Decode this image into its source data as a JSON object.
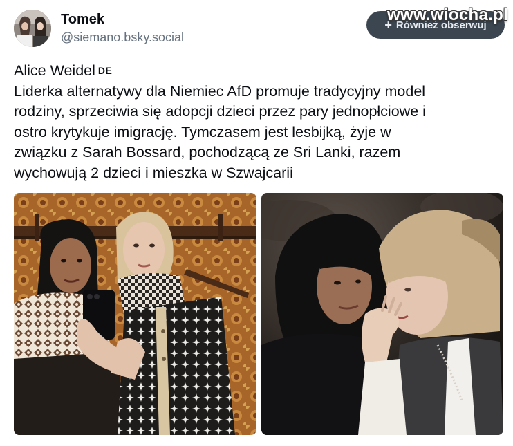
{
  "author": {
    "display_name": "Tomek",
    "handle": "@siemano.bsky.social",
    "avatar": "avatar-icon"
  },
  "follow_button": {
    "icon": "plus-icon",
    "label": "Również obserwuj"
  },
  "watermark": "www.wiocha.pl",
  "post": {
    "title": "Alice Weidel",
    "title_flag": "DE",
    "lines": [
      "Liderka alternatywy dla Niemiec AfD promuje tradycyjny model",
      "rodziny, sprzeciwia się adopcji dzieci przez pary jednopłciowe i",
      "ostro krytykuje imigrację. Tymczasem jest lesbijką, żyje w",
      "związku z Sarah Bossard, pochodzącą ze Sri Lanki, razem",
      "wychowują 2 dzieci i mieszka w Szwajcarii"
    ]
  },
  "images": [
    {
      "kind": "photo",
      "subject": "two-women-mirror-selfie"
    },
    {
      "kind": "photo",
      "subject": "two-women-whispering"
    }
  ],
  "colors": {
    "button_bg": "#3c4650",
    "handle": "#66727f",
    "text": "#0b0f14"
  }
}
